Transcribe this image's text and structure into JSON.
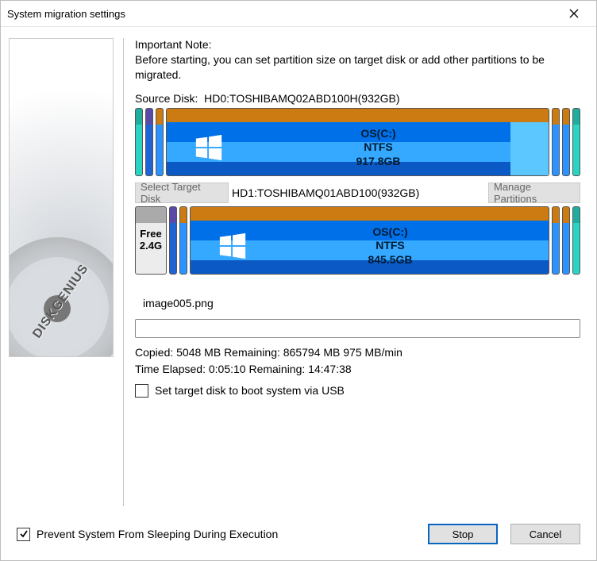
{
  "window": {
    "title": "System migration settings"
  },
  "note": {
    "heading": "Important Note:",
    "body": "Before starting, you can set partition size on target disk or add other partitions to be migrated."
  },
  "source": {
    "label_prefix": "Source Disk:",
    "disk": "HD0:TOSHIBAMQ02ABD100H(932GB)",
    "os_name": "OS(C:)",
    "fs": "NTFS",
    "size": "917.8GB"
  },
  "target": {
    "select_btn": "Select Target Disk",
    "disk": "HD1:TOSHIBAMQ01ABD100(932GB)",
    "manage_btn": "Manage Partitions",
    "free_label": "Free",
    "free_size": "2.4G",
    "os_name": "OS(C:)",
    "fs": "NTFS",
    "size": "845.5GB"
  },
  "file": {
    "name": "image005.png"
  },
  "progress": {
    "line1": "Copied:  5048 MB   Remaining: 865794 MB   975 MB/min",
    "line2": "Time Elapsed:  0:05:10   Remaining: 14:47:38"
  },
  "options": {
    "usb_boot": "Set target disk to boot system via USB",
    "prevent_sleep": "Prevent System From Sleeping During Execution"
  },
  "buttons": {
    "stop": "Stop",
    "cancel": "Cancel"
  },
  "sidebar": {
    "brand": "DISKGENIUS"
  }
}
